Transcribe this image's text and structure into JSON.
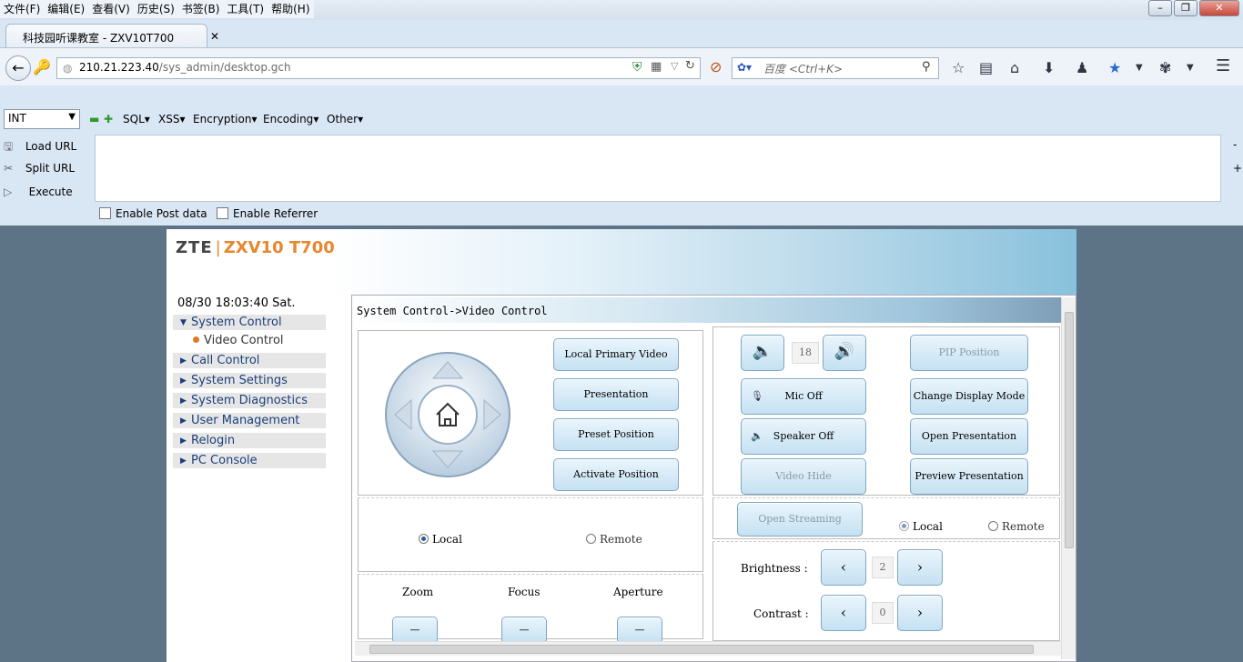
{
  "browser": {
    "menu": [
      "文件(F)",
      "编辑(E)",
      "查看(V)",
      "历史(S)",
      "书签(B)",
      "工具(T)",
      "帮助(H)"
    ],
    "tab_title": "科技园听课教室 - ZXV10T700",
    "url_host": "210.21.223.40",
    "url_path": "/sys_admin/desktop.gch",
    "search_placeholder": "百度 <Ctrl+K>"
  },
  "hackbar": {
    "select_value": "INT",
    "menus": [
      "SQL",
      "XSS",
      "Encryption",
      "Encoding",
      "Other"
    ],
    "actions": [
      "Load URL",
      "Split URL",
      "Execute"
    ],
    "enable_post": "Enable Post data",
    "enable_referrer": "Enable Referrer",
    "side_minus": "-",
    "side_plus": "+"
  },
  "app": {
    "logo_brand": "ZTE",
    "logo_model": "ZXV10 T700",
    "datetime": "08/30 18:03:40 Sat.",
    "nav": [
      "System Control",
      "Call Control",
      "System Settings",
      "System Diagnostics",
      "User Management",
      "Relogin",
      "PC Console"
    ],
    "subnav": "Video Control",
    "breadcrumb": "System Control->Video Control"
  },
  "controls": {
    "left_buttons": [
      "Local Primary Video",
      "Presentation",
      "Preset Position",
      "Activate Position"
    ],
    "local": "Local",
    "remote": "Remote",
    "zoom": "Zoom",
    "focus": "Focus",
    "aperture": "Aperture",
    "minus": "—",
    "volume": "18",
    "mic_off": "Mic Off",
    "speaker_off": "Speaker Off",
    "video_hide": "Video Hide",
    "pip_position": "PIP Position",
    "change_display_mode": "Change Display Mode",
    "open_presentation": "Open Presentation",
    "preview_presentation": "Preview Presentation",
    "open_streaming": "Open Streaming",
    "brightness": "Brightness :",
    "brightness_value": "2",
    "contrast": "Contrast :",
    "contrast_value": "0",
    "prev": "‹",
    "next": "›"
  }
}
